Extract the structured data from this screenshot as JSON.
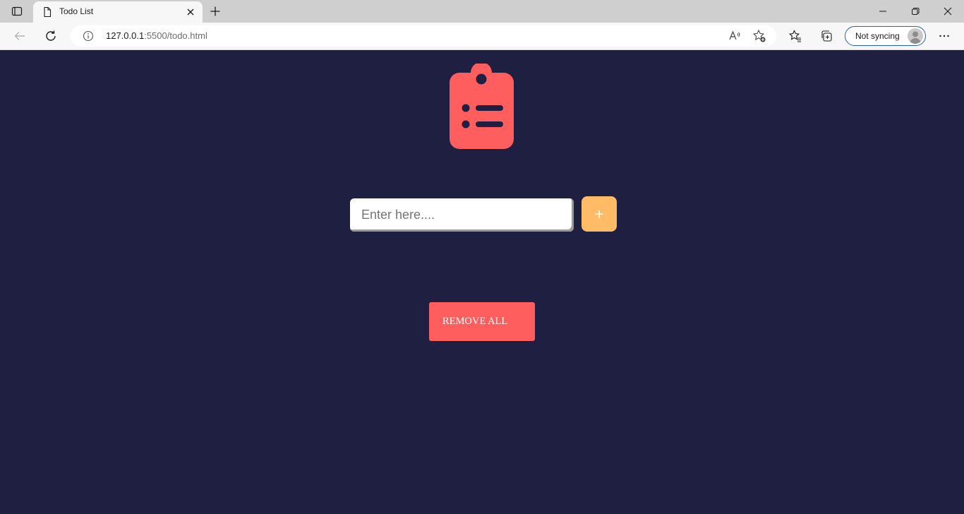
{
  "browser": {
    "tab": {
      "title": "Todo List"
    },
    "address_bar": {
      "host": "127.0.0.1",
      "rest": ":5500/todo.html"
    },
    "sync_button": {
      "label": "Not syncing"
    }
  },
  "app": {
    "input": {
      "placeholder": "Enter here...."
    },
    "add_button": {
      "label": "+"
    },
    "remove_all_button": {
      "label": "REMOVE ALL"
    }
  },
  "colors": {
    "background": "#1f2041",
    "accent_red": "#ff5e5e",
    "accent_orange": "#ffbb66"
  },
  "icons": {
    "tab_actions": "tab-actions-icon",
    "favicon": "page-icon",
    "close_tab": "close-icon",
    "new_tab": "plus-icon",
    "back": "back-arrow-icon",
    "refresh": "refresh-icon",
    "site_info": "info-icon",
    "read_aloud": "read-aloud-icon",
    "add_favorite": "star-plus-icon",
    "favorites": "favorites-icon",
    "collections": "collections-icon",
    "more": "more-icon",
    "app_logo": "clipboard-list-icon"
  }
}
